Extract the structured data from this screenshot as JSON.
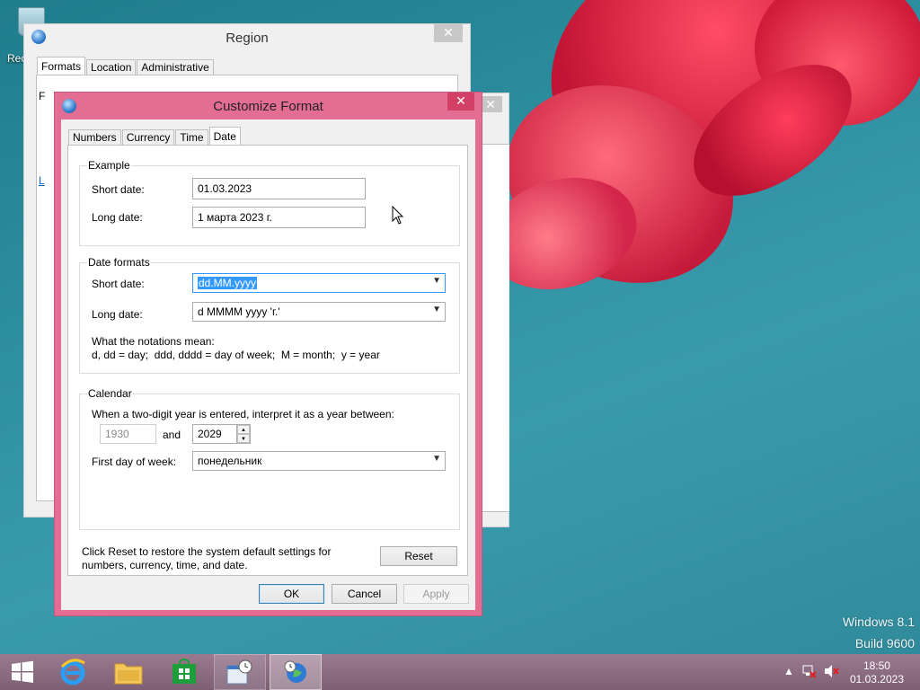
{
  "desktop": {
    "recycle_label": "Rec",
    "watermark_line1": "Windows 8.1",
    "watermark_line2": "Build 9600"
  },
  "region_window": {
    "title": "Region",
    "close": "✕",
    "tabs": [
      "Formats",
      "Location",
      "Administrative"
    ],
    "active_tab": "Formats",
    "partial_text_1": "F",
    "partial_text_2": "L"
  },
  "customize_window": {
    "title": "Customize Format",
    "close": "✕",
    "tabs": [
      "Numbers",
      "Currency",
      "Time",
      "Date"
    ],
    "active_tab": "Date",
    "example": {
      "title": "Example",
      "short_date_label": "Short date:",
      "short_date_value": "01.03.2023",
      "long_date_label": "Long date:",
      "long_date_value": "1 марта 2023 г."
    },
    "date_formats": {
      "title": "Date formats",
      "short_date_label": "Short date:",
      "short_date_value": "dd.MM.yyyy",
      "long_date_label": "Long date:",
      "long_date_value": "d MMMM yyyy 'г.'",
      "notation_heading": "What the notations mean:",
      "notation_text": "d, dd = day;  ddd, dddd = day of week;  M = month;  y = year"
    },
    "calendar": {
      "title": "Calendar",
      "two_digit_text": "When a two-digit year is entered, interpret it as a year between:",
      "year_from": "1930",
      "and_label": "and",
      "year_to": "2029",
      "first_day_label": "First day of week:",
      "first_day_value": "понедельник"
    },
    "reset_text_line1": "Click Reset to restore the system default settings for",
    "reset_text_line2": "numbers, currency, time, and date.",
    "reset_button": "Reset",
    "ok_button": "OK",
    "cancel_button": "Cancel",
    "apply_button": "Apply"
  },
  "taskbar": {
    "time": "18:50",
    "date": "01.03.2023",
    "items": [
      "start",
      "internet-explorer",
      "file-explorer",
      "store",
      "date-time-settings",
      "region-settings"
    ]
  },
  "colors": {
    "accent_window": "#e46d94",
    "taskbar": "#8a6a80",
    "selection": "#3399ff"
  }
}
